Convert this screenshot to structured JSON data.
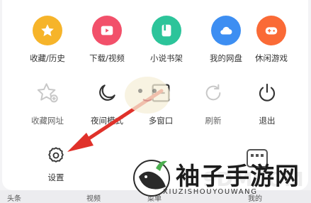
{
  "row1": [
    {
      "label": "收藏/历史",
      "icon": "star-icon",
      "color": "#F6B42A"
    },
    {
      "label": "下载/视频",
      "icon": "play-icon",
      "color": "#F2506A"
    },
    {
      "label": "小说书架",
      "icon": "book-icon",
      "color": "#2CC49A"
    },
    {
      "label": "我的网盘",
      "icon": "cloud-icon",
      "color": "#3D8EF2"
    },
    {
      "label": "休闲游戏",
      "icon": "gamepad-icon",
      "color": "#FA6A36"
    }
  ],
  "row2": [
    {
      "label": "收藏网址",
      "icon": "star-plus-icon"
    },
    {
      "label": "夜间模式",
      "icon": "moon-icon"
    },
    {
      "label": "多窗口",
      "icon": "window-icon"
    },
    {
      "label": "刷新",
      "icon": "refresh-icon"
    },
    {
      "label": "退出",
      "icon": "power-icon"
    }
  ],
  "row3": [
    {
      "label": "设置",
      "icon": "gear-icon"
    }
  ],
  "bottom_nav": [
    "头条",
    "视频",
    "菜单",
    "我的"
  ],
  "watermark": {
    "title": "袖子手游网",
    "subtitle": "XIUZISHOUYOUWANG",
    "faint_text": "9DMCOM"
  },
  "annotation_color": "#E0312A"
}
